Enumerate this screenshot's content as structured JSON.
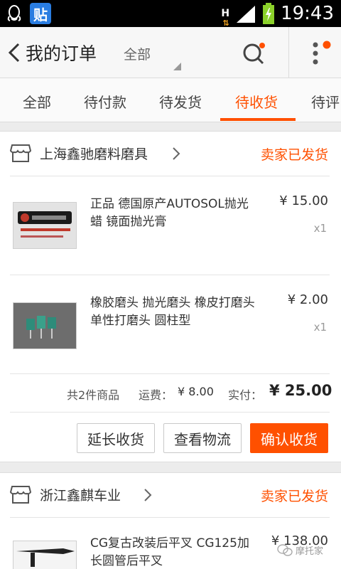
{
  "status_bar": {
    "app_badge": "贴",
    "network": "H",
    "time": "19:43"
  },
  "header": {
    "title": "我的订单",
    "filter": "全部",
    "icons": [
      "back-arrow-icon",
      "search-icon",
      "more-icon"
    ],
    "accent": "#ff5000"
  },
  "tabs": [
    {
      "label": "全部",
      "active": false
    },
    {
      "label": "待付款",
      "active": false
    },
    {
      "label": "待发货",
      "active": false
    },
    {
      "label": "待收货",
      "active": true
    },
    {
      "label": "待评",
      "active": false
    }
  ],
  "orders": [
    {
      "shop": "上海鑫驰磨料磨具",
      "status": "卖家已发货",
      "items": [
        {
          "title": "正品 德国原产AUTOSOL抛光蜡 镜面抛光膏",
          "price": "¥ 15.00",
          "qty": "x1"
        },
        {
          "title": "橡胶磨头 抛光磨头 橡皮打磨头 单性打磨头 圆柱型",
          "price": "¥ 2.00",
          "qty": "x1"
        }
      ],
      "summary": {
        "count": "共2件商品",
        "shipping_label": "运费：",
        "shipping_value": "¥ 8.00",
        "paid_label": "实付：",
        "paid_value": "¥ 25.00"
      },
      "actions": [
        "延长收货",
        "查看物流",
        "确认收货"
      ]
    },
    {
      "shop": "浙江鑫麒车业",
      "status": "卖家已发货",
      "items": [
        {
          "title": "CG复古改装后平叉 CG125加长圆管后平叉",
          "price": "¥ 138.00",
          "qty": ""
        }
      ]
    }
  ],
  "watermark": "摩托家"
}
